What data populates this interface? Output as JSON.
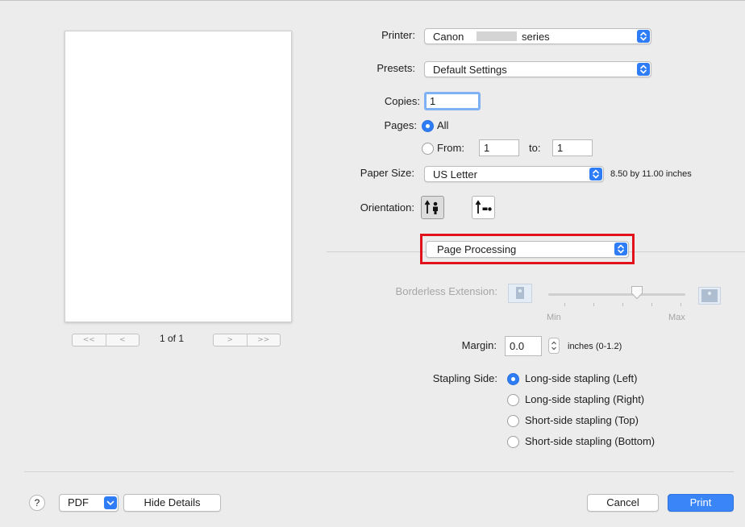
{
  "preview": {
    "page_indicator": "1 of 1"
  },
  "printer": {
    "label": "Printer:",
    "value_prefix": "Canon",
    "value_suffix": "series"
  },
  "presets": {
    "label": "Presets:",
    "value": "Default Settings"
  },
  "copies": {
    "label": "Copies:",
    "value": "1"
  },
  "pages": {
    "label": "Pages:",
    "all_label": "All",
    "from_label": "From:",
    "from_value": "1",
    "to_label": "to:",
    "to_value": "1",
    "selected": "all"
  },
  "paper_size": {
    "label": "Paper Size:",
    "value": "US Letter",
    "dimensions": "8.50 by 11.00 inches"
  },
  "orientation": {
    "label": "Orientation:",
    "selected": "portrait"
  },
  "panel_select": {
    "value": "Page Processing"
  },
  "borderless": {
    "label": "Borderless Extension:",
    "min_label": "Min",
    "max_label": "Max",
    "enabled": false,
    "level": 0.65
  },
  "margin": {
    "label": "Margin:",
    "value": "0.0",
    "unit": "inches (0-1.2)"
  },
  "stapling": {
    "label": "Stapling Side:",
    "options": [
      "Long-side stapling (Left)",
      "Long-side stapling (Right)",
      "Short-side stapling (Top)",
      "Short-side stapling (Bottom)"
    ],
    "selected_index": 0
  },
  "footer": {
    "help": "?",
    "pdf": "PDF",
    "hide_details": "Hide Details",
    "cancel": "Cancel",
    "print": "Print"
  },
  "colors": {
    "accent": "#2f7df6",
    "highlight_border": "#e1121b"
  }
}
